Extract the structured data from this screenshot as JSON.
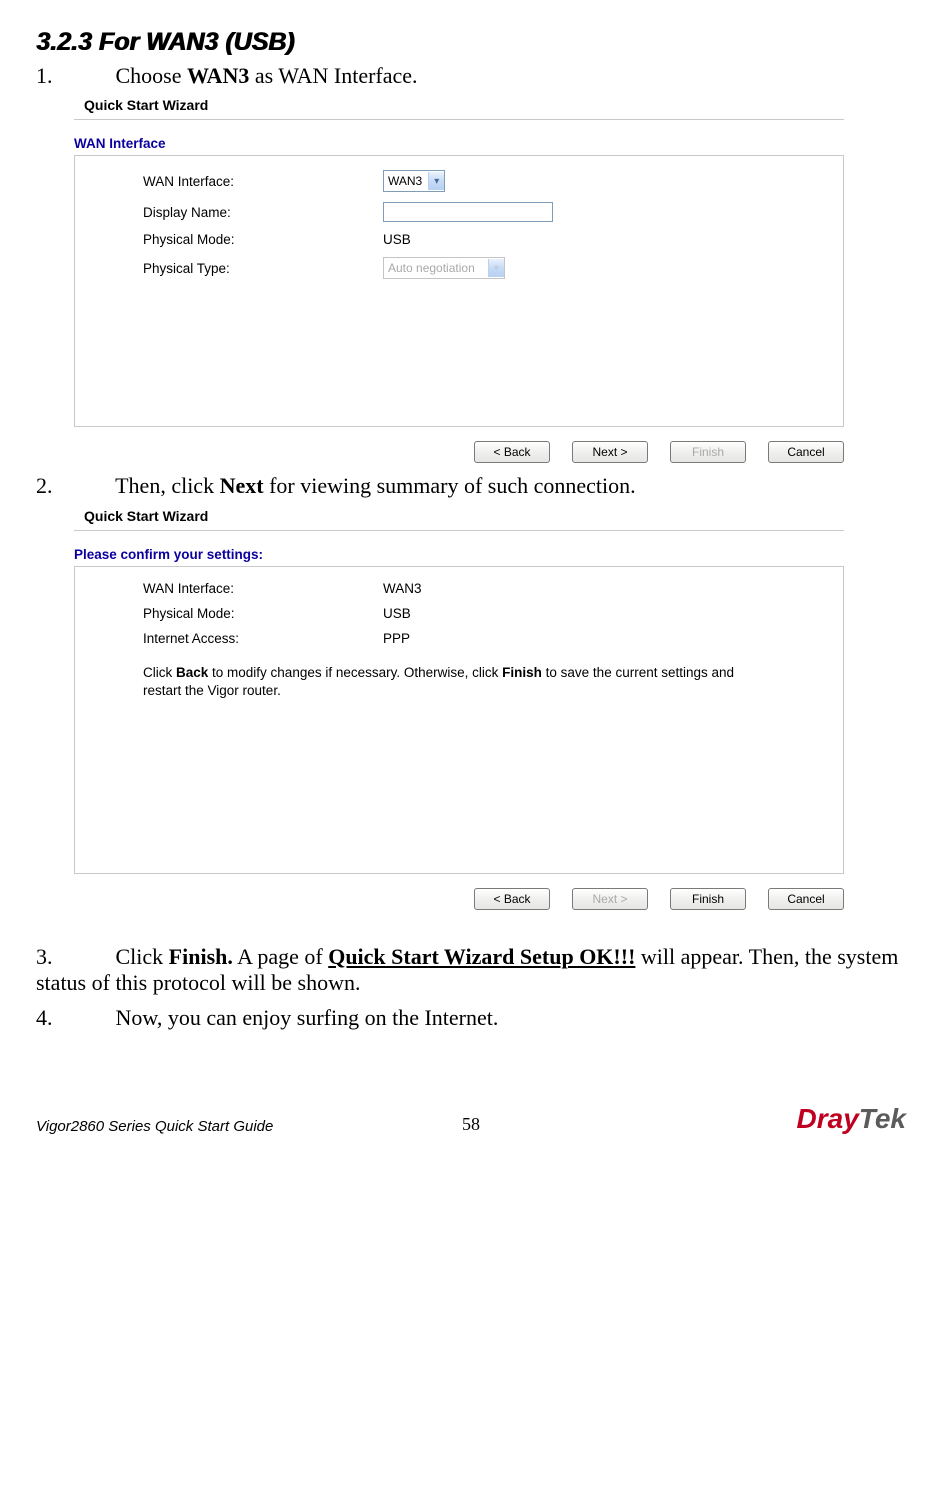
{
  "heading": "3.2.3 For WAN3 (USB)",
  "steps": {
    "s1_num": "1.",
    "s1_pre": "Choose ",
    "s1_bold": "WAN3",
    "s1_post": " as WAN Interface.",
    "s2_num": "2.",
    "s2_pre": "Then, click ",
    "s2_bold": "Next",
    "s2_post": " for viewing summary of such connection.",
    "s3_num": "3.",
    "s3_pre": "Click ",
    "s3_bold": "Finish.",
    "s3_mid": " A page of ",
    "s3_bold2": "Quick Start Wizard Setup OK!!!",
    "s3_post": " will appear. Then, the system status of this protocol will be shown.",
    "s4_num": "4.",
    "s4_text": "Now, you can enjoy surfing on the Internet."
  },
  "wiz1": {
    "title": "Quick Start Wizard",
    "subtitle": "WAN Interface",
    "labels": {
      "wan_if": "WAN Interface:",
      "display": "Display Name:",
      "pmode": "Physical Mode:",
      "ptype": "Physical Type:"
    },
    "values": {
      "wan_if": "WAN3",
      "display": "",
      "pmode": "USB",
      "ptype": "Auto negotiation"
    },
    "buttons": {
      "back": "< Back",
      "next": "Next >",
      "finish": "Finish",
      "cancel": "Cancel"
    }
  },
  "wiz2": {
    "title": "Quick Start Wizard",
    "subtitle": "Please confirm your settings:",
    "labels": {
      "wan_if": "WAN Interface:",
      "pmode": "Physical Mode:",
      "iaccess": "Internet Access:"
    },
    "values": {
      "wan_if": "WAN3",
      "pmode": "USB",
      "iaccess": "PPP"
    },
    "para_pre": "Click ",
    "para_b1": "Back",
    "para_mid": " to modify changes if necessary. Otherwise, click ",
    "para_b2": "Finish",
    "para_post": " to save the current settings and restart the Vigor router.",
    "buttons": {
      "back": "< Back",
      "next": "Next >",
      "finish": "Finish",
      "cancel": "Cancel"
    }
  },
  "footer": {
    "left": "Vigor2860 Series Quick Start Guide",
    "page": "58",
    "brand_dr": "Dray",
    "brand_tk": "Tek"
  }
}
